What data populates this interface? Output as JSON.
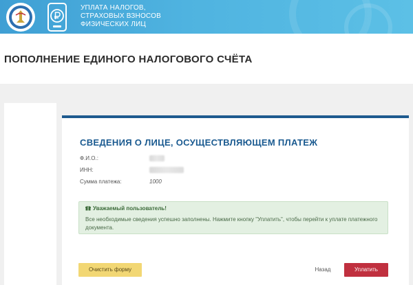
{
  "header": {
    "lines": [
      "УПЛАТА НАЛОГОВ,",
      "СТРАХОВЫХ ВЗНОСОВ",
      "ФИЗИЧЕСКИХ ЛИЦ"
    ],
    "emblem_icon": "fns-emblem-icon",
    "service_icon": "ruble-phone-icon"
  },
  "page": {
    "title": "ПОПОЛНЕНИЕ ЕДИНОГО НАЛОГОВОГО СЧЁТА"
  },
  "section": {
    "title": "СВЕДЕНИЯ О ЛИЦЕ, ОСУЩЕСТВЛЯЮЩЕМ ПЛАТЕЖ",
    "fields": [
      {
        "label": "Ф.И.О.:",
        "value": ""
      },
      {
        "label": "ИНН:",
        "value": ""
      },
      {
        "label": "Сумма платежа:",
        "value": "1000"
      }
    ]
  },
  "alert": {
    "title": "Уважаемый пользователь!",
    "text": "Все необходимые сведения успешно заполнены. Нажмите кнопку \"Уплатить\", чтобы перейти к уплате платежного документа.",
    "icon": "gift-icon"
  },
  "buttons": {
    "clear_label": "Очистить форму",
    "back_label": "Назад",
    "pay_label": "Уплатить"
  },
  "colors": {
    "header": "#4fb3e0",
    "accent": "#1e5a8e",
    "pay_button": "#c0303f",
    "clear_button": "#f2d774",
    "alert_bg": "#e3f0e2"
  }
}
